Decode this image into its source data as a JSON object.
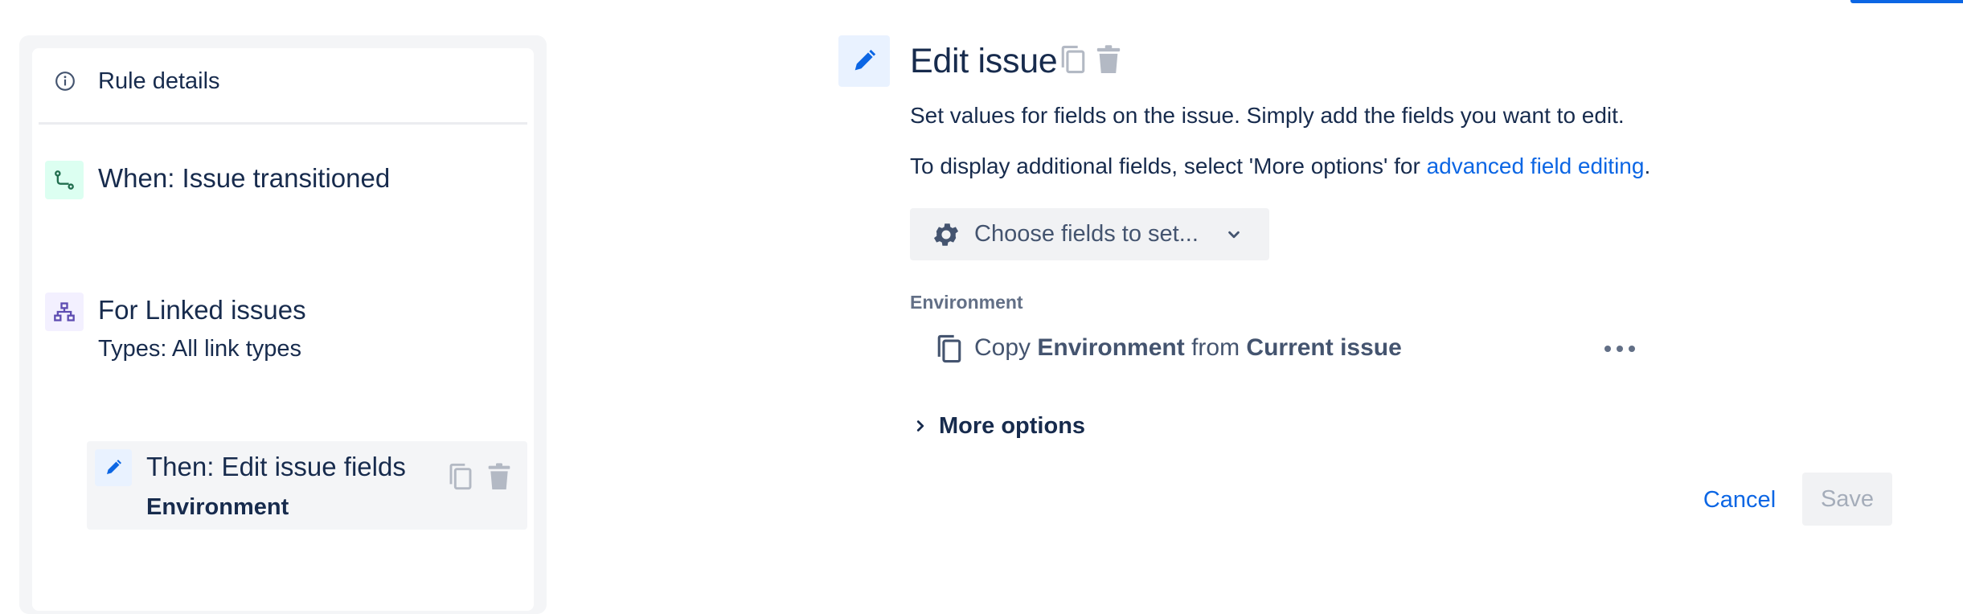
{
  "rule": {
    "details_label": "Rule details",
    "trigger": {
      "title": "When: Issue transitioned"
    },
    "branch": {
      "title": "For Linked issues",
      "subtitle": "Types: All link types"
    },
    "action": {
      "title": "Then: Edit issue fields",
      "subtitle": "Environment"
    }
  },
  "edit": {
    "title": "Edit issue",
    "description_1": "Set values for fields on the issue. Simply add the fields you want to edit.",
    "description_2_prefix": "To display additional fields, select 'More options' for ",
    "description_2_link": "advanced field editing",
    "description_2_suffix": ".",
    "choose_fields_label": "Choose fields to set...",
    "field_label": "Environment",
    "copy_row": {
      "prefix": "Copy ",
      "field": "Environment",
      "middle": " from ",
      "source": "Current issue"
    },
    "more_options_label": "More options",
    "cancel_label": "Cancel",
    "save_label": "Save"
  },
  "colors": {
    "accent": "#0c66e4",
    "trigger_icon_bg": "#dcfff1",
    "branch_icon_bg": "#f3f0ff",
    "action_icon_bg": "#e9f2ff"
  },
  "icons": [
    "info-icon",
    "trigger-icon",
    "branch-icon",
    "pencil-icon",
    "copy-icon",
    "trash-icon",
    "gear-icon",
    "chevron-down-icon",
    "chevron-right-icon",
    "more-icon"
  ]
}
